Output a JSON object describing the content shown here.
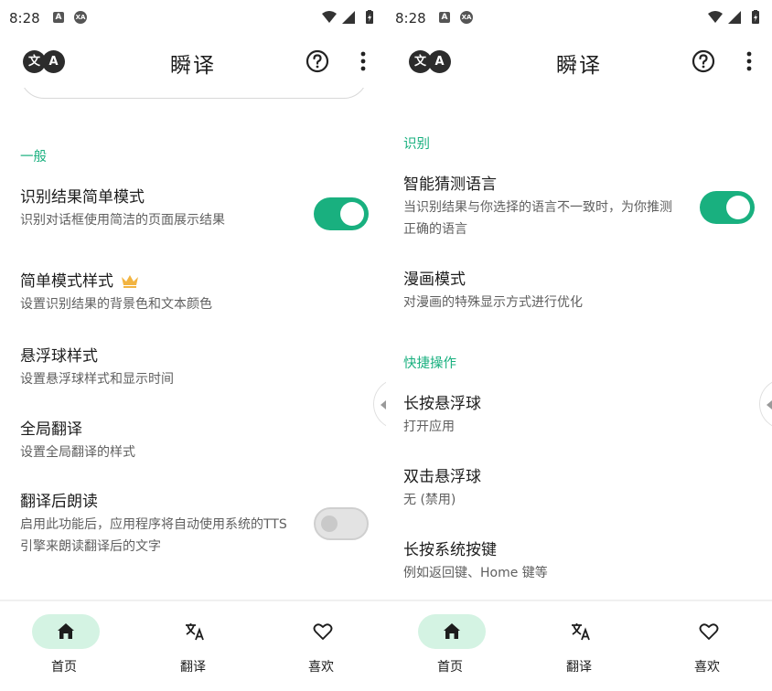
{
  "status": {
    "time": "8:28",
    "icon_a": "A",
    "icon_xa": "XA"
  },
  "app": {
    "title": "瞬译",
    "logo_left": "文",
    "logo_right": "A"
  },
  "left": {
    "section_general": "一般",
    "items": [
      {
        "title": "识别结果简单模式",
        "subtitle": "识别对话框使用简洁的页面展示结果",
        "toggle": "on"
      },
      {
        "title": "简单模式样式",
        "subtitle": "设置识别结果的背景色和文本颜色",
        "premium": true
      },
      {
        "title": "悬浮球样式",
        "subtitle": "设置悬浮球样式和显示时间"
      },
      {
        "title": "全局翻译",
        "subtitle": "设置全局翻译的样式"
      },
      {
        "title": "翻译后朗读",
        "subtitle": "启用此功能后，应用程序将自动使用系统的TTS引擎来朗读翻译后的文字",
        "toggle": "off"
      }
    ]
  },
  "right": {
    "section_recognize": "识别",
    "section_quick": "快捷操作",
    "items": [
      {
        "title": "智能猜测语言",
        "subtitle": "当识别结果与你选择的语言不一致时，为你推测正确的语言",
        "toggle": "on"
      },
      {
        "title": "漫画模式",
        "subtitle": "对漫画的特殊显示方式进行优化"
      },
      {
        "title": "长按悬浮球",
        "subtitle": "打开应用"
      },
      {
        "title": "双击悬浮球",
        "subtitle": "无 (禁用)"
      },
      {
        "title": "长按系统按键",
        "subtitle": "例如返回键、Home 键等"
      }
    ]
  },
  "nav": [
    {
      "label": "首页",
      "icon": "home-icon",
      "active": true
    },
    {
      "label": "翻译",
      "icon": "translate-icon",
      "active": false
    },
    {
      "label": "喜欢",
      "icon": "heart-icon",
      "active": false
    }
  ],
  "colors": {
    "accent": "#19b07f",
    "active_pill": "#d4f3e3",
    "text": "#1c1c1c",
    "subtext": "#5f5f5f"
  }
}
